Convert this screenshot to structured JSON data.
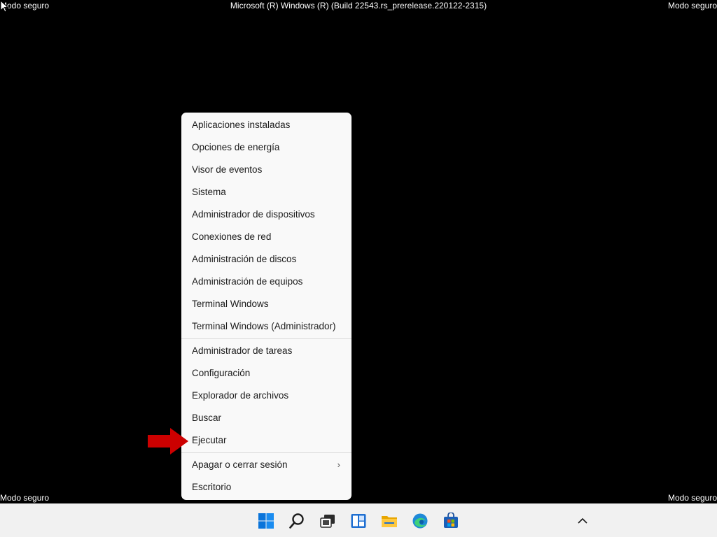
{
  "watermark": {
    "top_left": "Modo seguro",
    "top_center": "Microsoft (R) Windows (R) (Build 22543.rs_prerelease.220122-2315)",
    "top_right": "Modo seguro",
    "bottom_left": "Modo seguro",
    "bottom_right": "Modo seguro"
  },
  "menu": {
    "group1": [
      "Aplicaciones instaladas",
      "Opciones de energía",
      "Visor de eventos",
      "Sistema",
      "Administrador de dispositivos",
      "Conexiones de red",
      "Administración de discos",
      "Administración de equipos",
      "Terminal Windows",
      "Terminal Windows (Administrador)"
    ],
    "group2": [
      "Administrador de tareas",
      "Configuración",
      "Explorador de archivos",
      "Buscar",
      "Ejecutar"
    ],
    "group3": [
      "Apagar o cerrar sesión",
      "Escritorio"
    ],
    "submenu_indicator": "›"
  },
  "annotation": {
    "arrow_color": "#cc0000",
    "points_to": "Ejecutar"
  },
  "taskbar": {
    "icons": [
      "start-icon",
      "search-icon",
      "task-view-icon",
      "widgets-icon",
      "file-explorer-icon",
      "edge-icon",
      "store-icon"
    ],
    "tray_icon": "chevron-up-icon"
  },
  "colors": {
    "desktop": "#000000",
    "menu_bg": "#f9f9f9",
    "taskbar_bg": "#f1f1f1",
    "accent": "#0067c0"
  }
}
